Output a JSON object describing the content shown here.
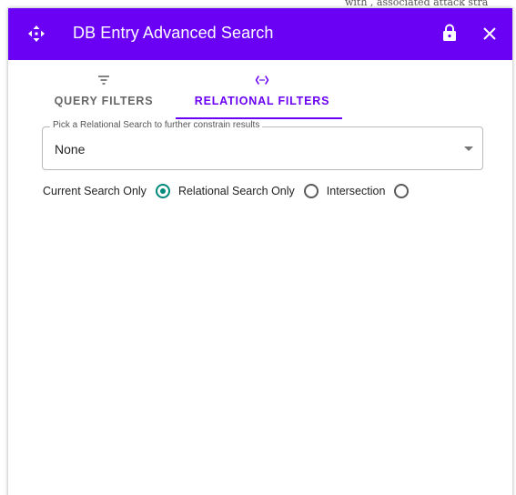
{
  "background": {
    "partial_text": "with , associated attack stra"
  },
  "colors": {
    "accent": "#6a00f4",
    "radio_checked": "#00897b"
  },
  "dialog": {
    "title": "DB Entry Advanced Search",
    "icons": {
      "move": "move-icon",
      "lock": "lock-icon",
      "close": "close-icon"
    }
  },
  "tabs": [
    {
      "label": "QUERY FILTERS",
      "icon": "filter-icon",
      "active": false
    },
    {
      "label": "RELATIONAL FILTERS",
      "icon": "code-icon",
      "active": true
    }
  ],
  "relational_select": {
    "label": "Pick a Relational Search to further constrain results",
    "value": "None"
  },
  "radio_options": [
    {
      "label": "Current Search Only",
      "checked": true
    },
    {
      "label": "Relational Search Only",
      "checked": false
    },
    {
      "label": "Intersection",
      "checked": false
    }
  ]
}
